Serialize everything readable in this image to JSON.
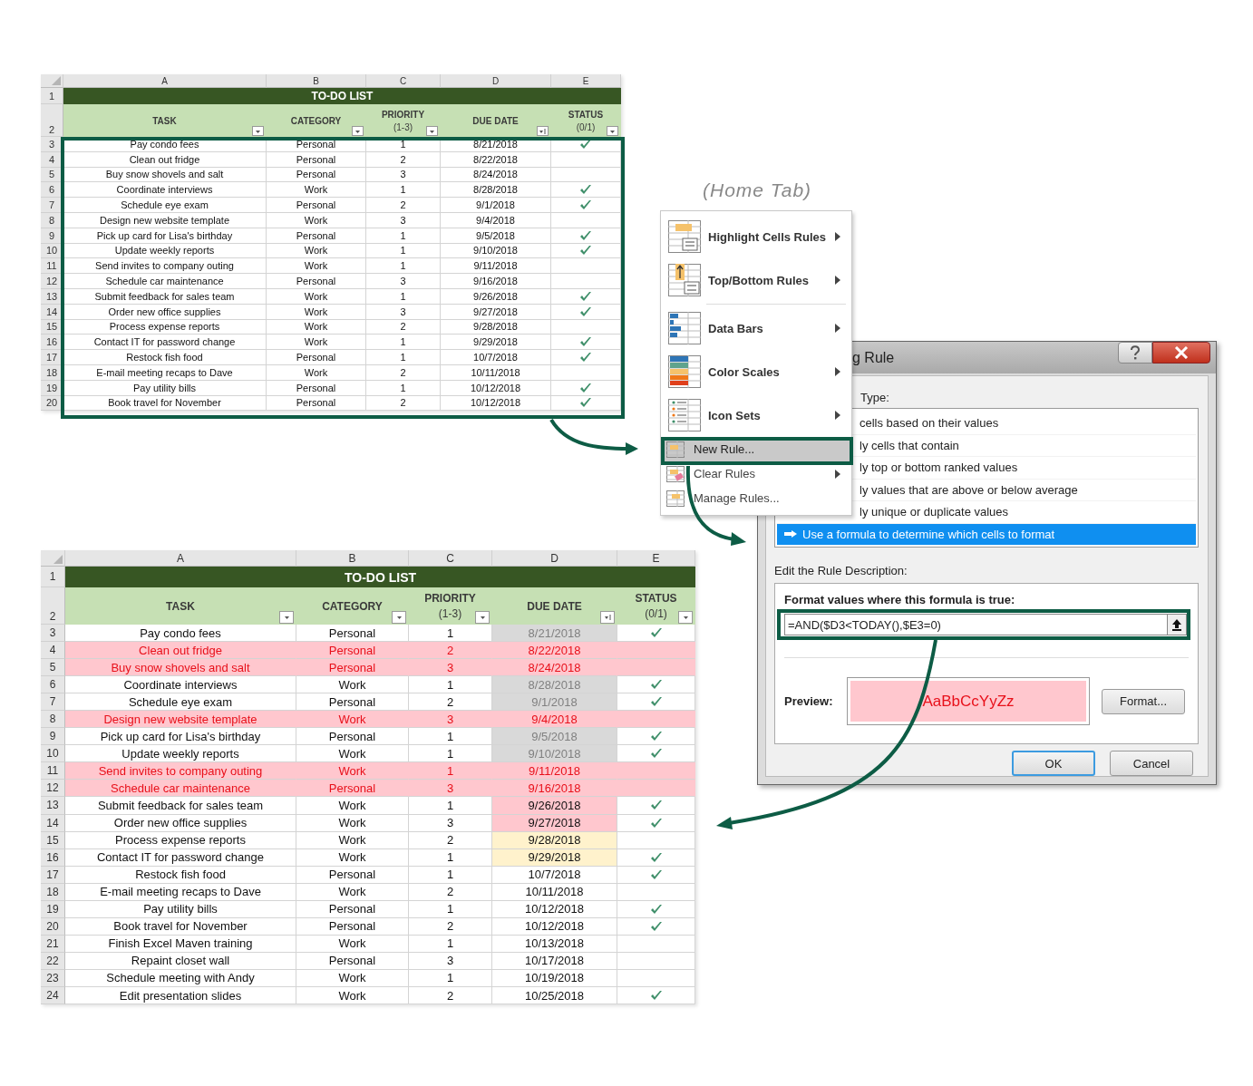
{
  "top_sheet": {
    "column_letters": [
      "A",
      "B",
      "C",
      "D",
      "E"
    ],
    "title_row": "1",
    "header_row": "2",
    "title": "TO-DO LIST",
    "headers": [
      {
        "label": "TASK",
        "kind": "filter"
      },
      {
        "label": "CATEGORY",
        "kind": "filter"
      },
      {
        "label": "PRIORITY",
        "sub": "(1-3)",
        "kind": "filter"
      },
      {
        "label": "DUE DATE",
        "kind": "sorted"
      },
      {
        "label": "STATUS",
        "sub": "(0/1)",
        "kind": "filter"
      }
    ],
    "rows": [
      {
        "num": "3",
        "task": "Pay condo fees",
        "category": "Personal",
        "priority": "1",
        "due": "8/21/2018",
        "done": true
      },
      {
        "num": "4",
        "task": "Clean out fridge",
        "category": "Personal",
        "priority": "2",
        "due": "8/22/2018",
        "done": false
      },
      {
        "num": "5",
        "task": "Buy snow shovels and salt",
        "category": "Personal",
        "priority": "3",
        "due": "8/24/2018",
        "done": false
      },
      {
        "num": "6",
        "task": "Coordinate interviews",
        "category": "Work",
        "priority": "1",
        "due": "8/28/2018",
        "done": true
      },
      {
        "num": "7",
        "task": "Schedule eye exam",
        "category": "Personal",
        "priority": "2",
        "due": "9/1/2018",
        "done": true
      },
      {
        "num": "8",
        "task": "Design new website template",
        "category": "Work",
        "priority": "3",
        "due": "9/4/2018",
        "done": false
      },
      {
        "num": "9",
        "task": "Pick up card for Lisa's birthday",
        "category": "Personal",
        "priority": "1",
        "due": "9/5/2018",
        "done": true
      },
      {
        "num": "10",
        "task": "Update weekly reports",
        "category": "Work",
        "priority": "1",
        "due": "9/10/2018",
        "done": true
      },
      {
        "num": "11",
        "task": "Send invites to company outing",
        "category": "Work",
        "priority": "1",
        "due": "9/11/2018",
        "done": false
      },
      {
        "num": "12",
        "task": "Schedule car maintenance",
        "category": "Personal",
        "priority": "3",
        "due": "9/16/2018",
        "done": false
      },
      {
        "num": "13",
        "task": "Submit feedback for sales team",
        "category": "Work",
        "priority": "1",
        "due": "9/26/2018",
        "done": true
      },
      {
        "num": "14",
        "task": "Order new office supplies",
        "category": "Work",
        "priority": "3",
        "due": "9/27/2018",
        "done": true
      },
      {
        "num": "15",
        "task": "Process expense reports",
        "category": "Work",
        "priority": "2",
        "due": "9/28/2018",
        "done": false
      },
      {
        "num": "16",
        "task": "Contact IT for password change",
        "category": "Work",
        "priority": "1",
        "due": "9/29/2018",
        "done": true
      },
      {
        "num": "17",
        "task": "Restock fish food",
        "category": "Personal",
        "priority": "1",
        "due": "10/7/2018",
        "done": true
      },
      {
        "num": "18",
        "task": "E-mail meeting recaps to Dave",
        "category": "Work",
        "priority": "2",
        "due": "10/11/2018",
        "done": false
      },
      {
        "num": "19",
        "task": "Pay utility bills",
        "category": "Personal",
        "priority": "1",
        "due": "10/12/2018",
        "done": true
      },
      {
        "num": "20",
        "task": "Book travel for November",
        "category": "Personal",
        "priority": "2",
        "due": "10/12/2018",
        "done": true
      }
    ]
  },
  "caption": "(Home Tab)",
  "menu": {
    "items": [
      {
        "kind": "highlight",
        "label": "Highlight Cells Rules",
        "submenu": true,
        "selected": false
      },
      {
        "kind": "topbottom",
        "label": "Top/Bottom Rules",
        "submenu": true,
        "selected": false
      },
      {
        "kind": "separator"
      },
      {
        "kind": "databars",
        "label": "Data Bars",
        "submenu": true,
        "selected": false
      },
      {
        "kind": "colorscales",
        "label": "Color Scales",
        "submenu": true,
        "selected": false
      },
      {
        "kind": "iconsets",
        "label": "Icon Sets",
        "submenu": true,
        "selected": false
      },
      {
        "kind": "newrule",
        "label": "New Rule...",
        "submenu": false,
        "selected": true
      },
      {
        "kind": "clearrules",
        "label": "Clear Rules",
        "submenu": true,
        "selected": false
      },
      {
        "kind": "managerules",
        "label": "Manage Rules...",
        "submenu": false,
        "selected": false
      }
    ]
  },
  "dialog": {
    "title": "g Rule",
    "type_label": "Type:",
    "rule_types": [
      {
        "label": "cells based on their values",
        "selected": false
      },
      {
        "label": "ly cells that contain",
        "selected": false
      },
      {
        "label": "ly top or bottom ranked values",
        "selected": false
      },
      {
        "label": "ly values that are above or below average",
        "selected": false
      },
      {
        "label": "ly unique or duplicate values",
        "selected": false
      },
      {
        "label": "Use a formula to determine which cells to format",
        "selected": true
      }
    ],
    "description_label": "Edit the Rule Description:",
    "formula_label": "Format values where this formula is true:",
    "formula": "=AND($D3<TODAY(),$E3=0)",
    "preview_label": "Preview:",
    "preview_text": "AaBbCcYyZz",
    "format_button": "Format...",
    "buttons": [
      {
        "label": "OK",
        "default": true
      },
      {
        "label": "Cancel",
        "default": false
      }
    ]
  },
  "bottom_sheet": {
    "column_letters": [
      "A",
      "B",
      "C",
      "D",
      "E"
    ],
    "title_row": "1",
    "header_row": "2",
    "title": "TO-DO LIST",
    "headers": [
      {
        "label": "TASK",
        "kind": "filter"
      },
      {
        "label": "CATEGORY",
        "kind": "filter"
      },
      {
        "label": "PRIORITY",
        "sub": "(1-3)",
        "kind": "filter"
      },
      {
        "label": "DUE DATE",
        "kind": "sorted"
      },
      {
        "label": "STATUS",
        "sub": "(0/1)",
        "kind": "filter"
      }
    ],
    "rows": [
      {
        "kind": "past",
        "num": "3",
        "task": "Pay condo fees",
        "category": "Personal",
        "priority": "1",
        "due": "8/21/2018",
        "done": true
      },
      {
        "kind": "overdue",
        "num": "4",
        "task": "Clean out fridge",
        "category": "Personal",
        "priority": "2",
        "due": "8/22/2018",
        "done": false
      },
      {
        "kind": "overdue",
        "num": "5",
        "task": "Buy snow shovels and salt",
        "category": "Personal",
        "priority": "3",
        "due": "8/24/2018",
        "done": false
      },
      {
        "kind": "past",
        "num": "6",
        "task": "Coordinate interviews",
        "category": "Work",
        "priority": "1",
        "due": "8/28/2018",
        "done": true
      },
      {
        "kind": "past",
        "num": "7",
        "task": "Schedule eye exam",
        "category": "Personal",
        "priority": "2",
        "due": "9/1/2018",
        "done": true
      },
      {
        "kind": "overdue",
        "num": "8",
        "task": "Design new website template",
        "category": "Work",
        "priority": "3",
        "due": "9/4/2018",
        "done": false
      },
      {
        "kind": "past",
        "num": "9",
        "task": "Pick up card for Lisa's birthday",
        "category": "Personal",
        "priority": "1",
        "due": "9/5/2018",
        "done": true
      },
      {
        "kind": "past",
        "num": "10",
        "task": "Update weekly reports",
        "category": "Work",
        "priority": "1",
        "due": "9/10/2018",
        "done": true
      },
      {
        "kind": "overdue",
        "num": "11",
        "task": "Send invites to company outing",
        "category": "Work",
        "priority": "1",
        "due": "9/11/2018",
        "done": false
      },
      {
        "kind": "overdue",
        "num": "12",
        "task": "Schedule car maintenance",
        "category": "Personal",
        "priority": "3",
        "due": "9/16/2018",
        "done": false
      },
      {
        "kind": "due",
        "num": "13",
        "task": "Submit feedback for sales team",
        "category": "Work",
        "priority": "1",
        "due": "9/26/2018",
        "done": true
      },
      {
        "kind": "due",
        "num": "14",
        "task": "Order new office supplies",
        "category": "Work",
        "priority": "3",
        "due": "9/27/2018",
        "done": true
      },
      {
        "kind": "upcoming",
        "num": "15",
        "task": "Process expense reports",
        "category": "Work",
        "priority": "2",
        "due": "9/28/2018",
        "done": false
      },
      {
        "kind": "upcoming",
        "num": "16",
        "task": "Contact IT for password change",
        "category": "Work",
        "priority": "1",
        "due": "9/29/2018",
        "done": true
      },
      {
        "kind": "normal",
        "num": "17",
        "task": "Restock fish food",
        "category": "Personal",
        "priority": "1",
        "due": "10/7/2018",
        "done": true
      },
      {
        "kind": "normal",
        "num": "18",
        "task": "E-mail meeting recaps to Dave",
        "category": "Work",
        "priority": "2",
        "due": "10/11/2018",
        "done": false
      },
      {
        "kind": "normal",
        "num": "19",
        "task": "Pay utility bills",
        "category": "Personal",
        "priority": "1",
        "due": "10/12/2018",
        "done": true
      },
      {
        "kind": "normal",
        "num": "20",
        "task": "Book travel for November",
        "category": "Personal",
        "priority": "2",
        "due": "10/12/2018",
        "done": true
      },
      {
        "kind": "normal",
        "num": "21",
        "task": "Finish Excel Maven training",
        "category": "Work",
        "priority": "1",
        "due": "10/13/2018",
        "done": false
      },
      {
        "kind": "normal",
        "num": "22",
        "task": "Repaint closet wall",
        "category": "Personal",
        "priority": "3",
        "due": "10/17/2018",
        "done": false
      },
      {
        "kind": "normal",
        "num": "23",
        "task": "Schedule meeting with Andy",
        "category": "Work",
        "priority": "1",
        "due": "10/19/2018",
        "done": false
      },
      {
        "kind": "normal",
        "num": "24",
        "task": "Edit presentation slides",
        "category": "Work",
        "priority": "2",
        "due": "10/25/2018",
        "done": true
      }
    ]
  }
}
